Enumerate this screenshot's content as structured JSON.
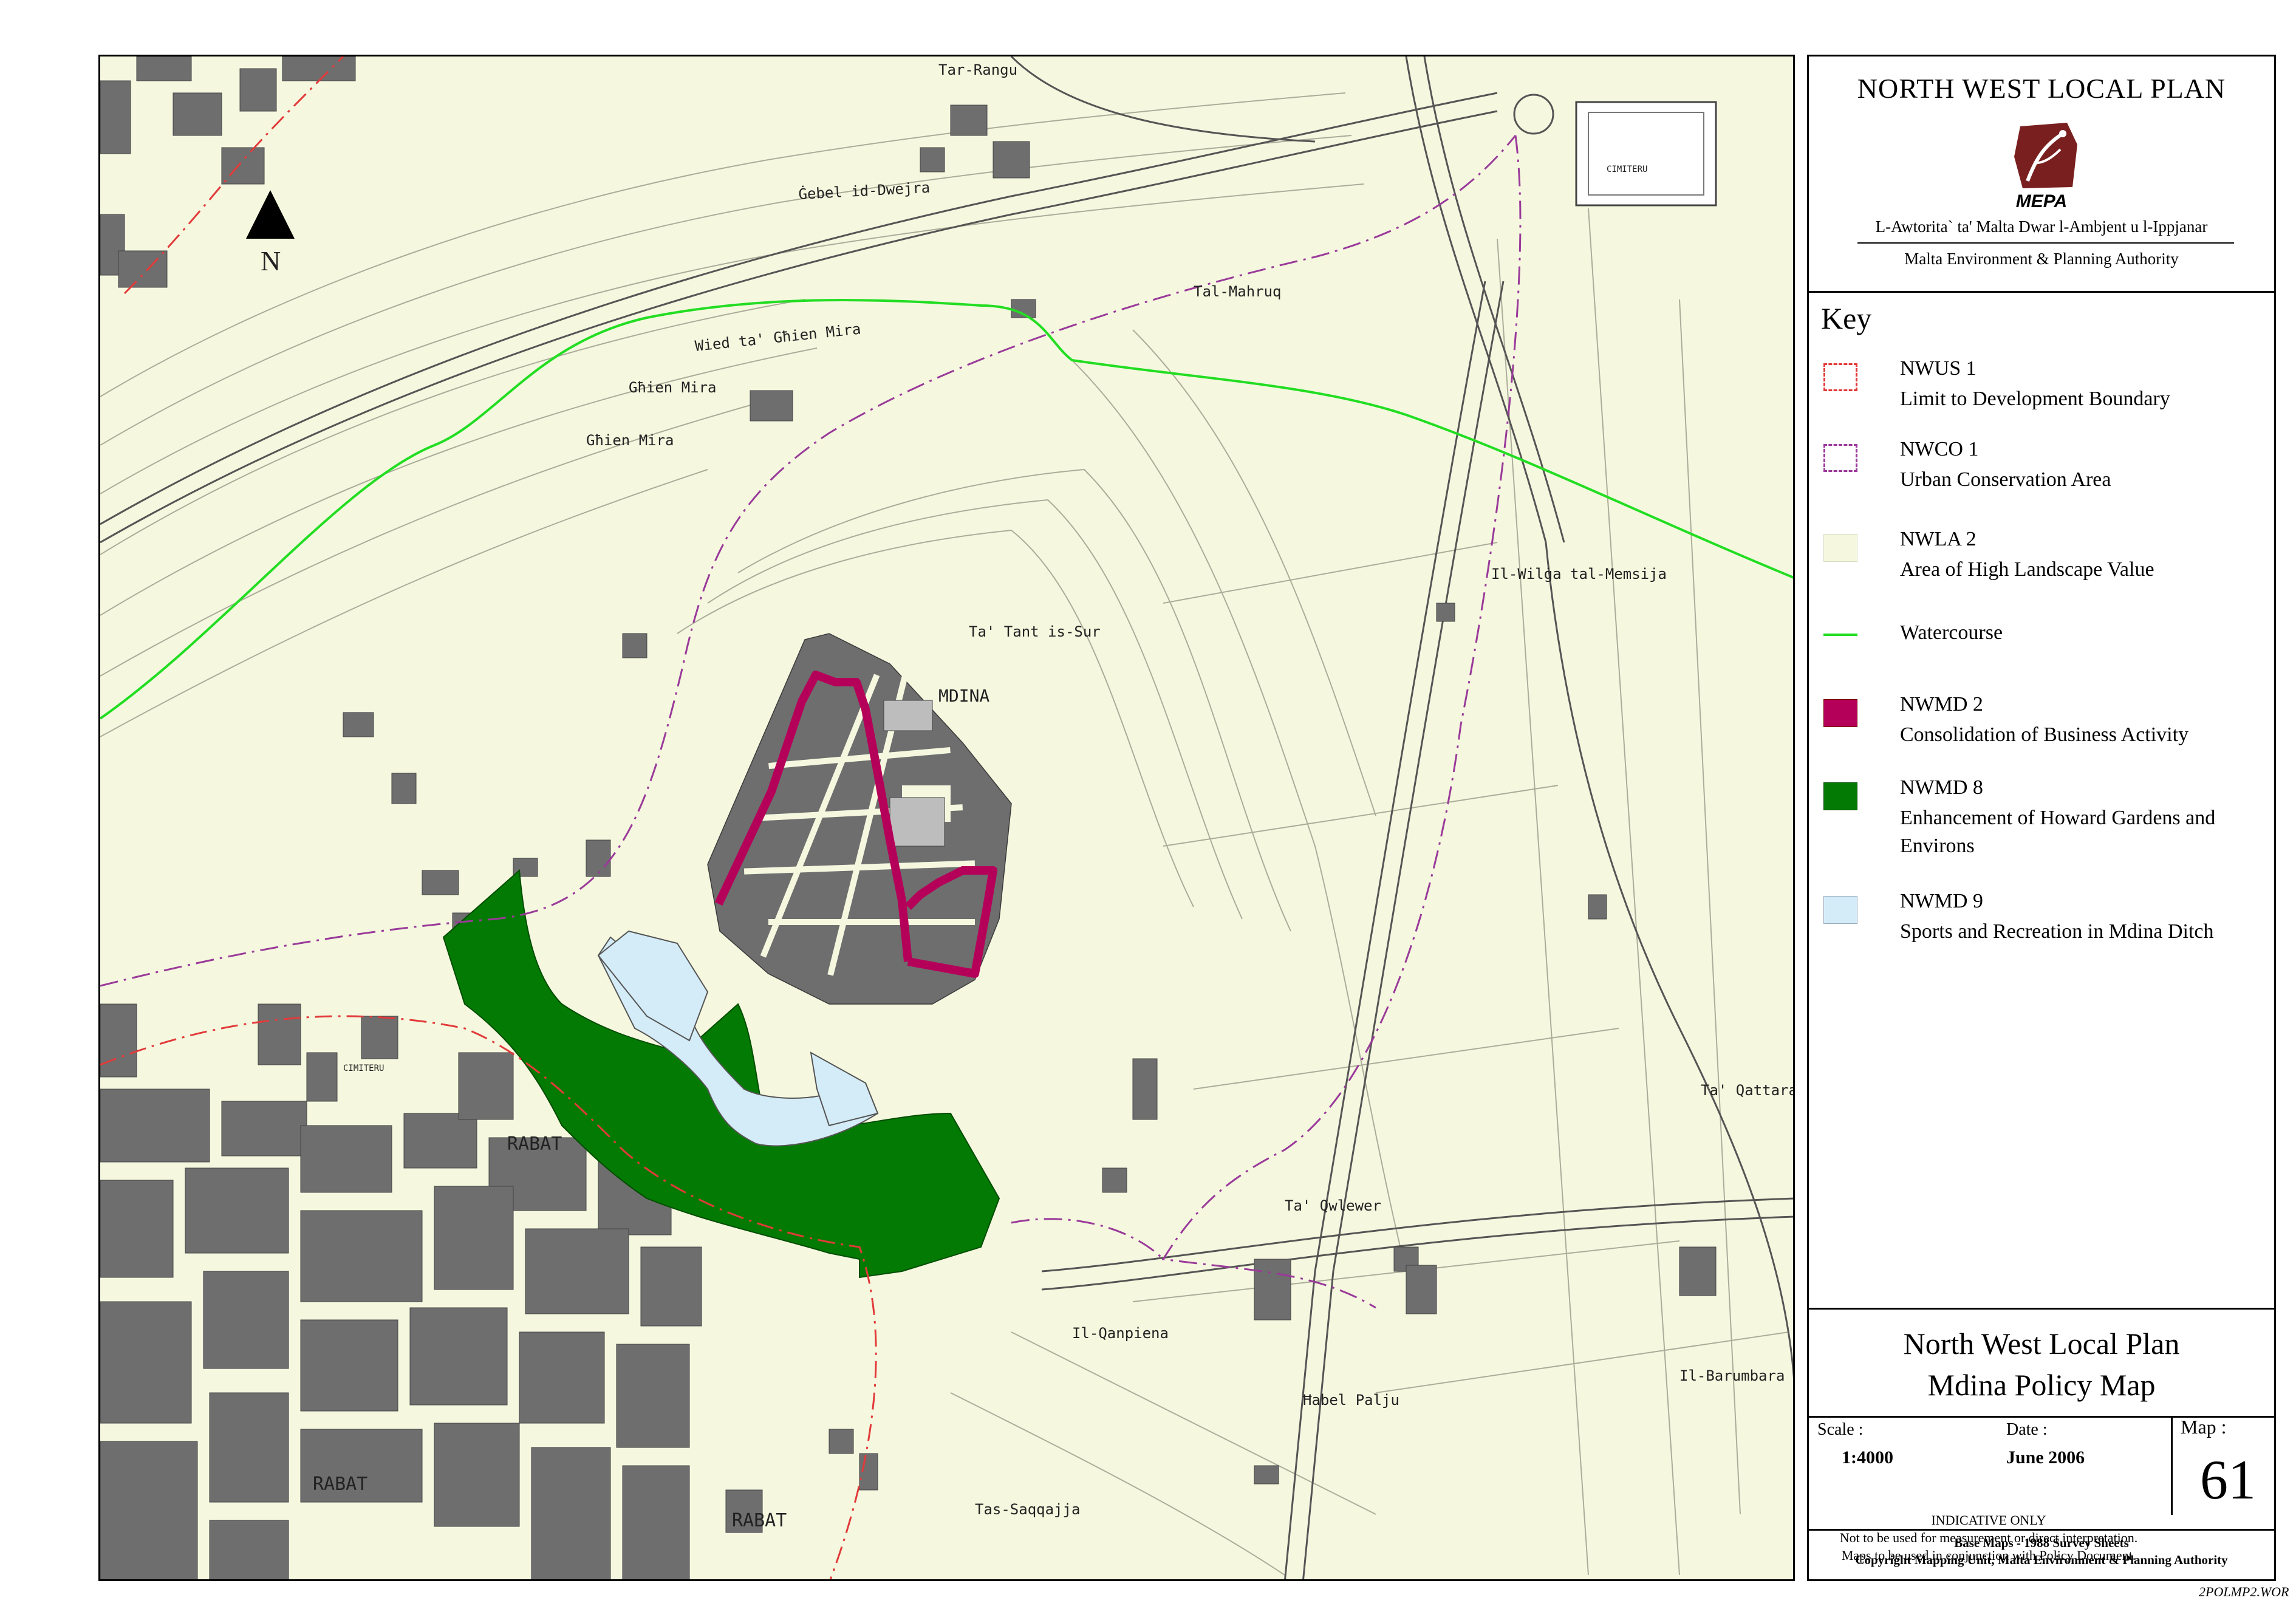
{
  "panel": {
    "plan_title": "NORTH WEST LOCAL PLAN",
    "logo_text": "MEPA",
    "authority_mt": "L-Awtorita` ta' Malta Dwar l-Ambjent u l-Ippjanar",
    "authority_en": "Malta Environment & Planning Authority",
    "key_title": "Key",
    "legend": [
      {
        "code": "NWUS 1",
        "label": "Limit to Development Boundary",
        "style": "dashed",
        "color": "#e23a3a"
      },
      {
        "code": "NWCO 1",
        "label": "Urban Conservation Area",
        "style": "dashdot",
        "color": "#9a3a9a"
      },
      {
        "code": "NWLA 2",
        "label": "Area of High Landscape Value",
        "style": "fill",
        "color": "#f5f8df"
      },
      {
        "code": "",
        "label": "Watercourse",
        "style": "line",
        "color": "#22dd22"
      },
      {
        "code": "NWMD 2",
        "label": "Consolidation of Business Activity",
        "style": "fill",
        "color": "#b5005a"
      },
      {
        "code": "NWMD 8",
        "label": "Enhancement of Howard Gardens and Environs",
        "style": "fill",
        "color": "#037a03"
      },
      {
        "code": "NWMD 9",
        "label": "Sports and Recreation in Mdina Ditch",
        "style": "fill",
        "color": "#d4ecf7"
      }
    ],
    "subtitle_1": "North West Local Plan",
    "subtitle_2": "Mdina Policy Map",
    "scale_label": "Scale :",
    "scale_value": "1:4000",
    "date_label": "Date :",
    "date_value": "June 2006",
    "map_label": "Map :",
    "map_number": "61",
    "disclaimer": [
      "INDICATIVE ONLY",
      "Not to be used for measurement or direct interpretation.",
      "Maps to be used in conjunction with Policy Document."
    ],
    "base_maps": [
      "Base Maps - 1988 Survey Sheets",
      "Copyright Mapping Unit, Malta Environment & Planning Authority"
    ]
  },
  "file_ref": "2POLMP2.WOR",
  "map": {
    "north_label": "N",
    "place_labels": [
      "Tar-Rangu",
      "Ġebel id-Dwejra",
      "Tal-Mahruq",
      "Wied ta' Għien Mira",
      "Għien Mira",
      "Għien Mira",
      "Il-Wilġa tal-Memsija",
      "Ta' Tant is-Sur",
      "MDINA",
      "Ta' Qattara",
      "Ta' Qwlewer",
      "Il-Qanpiena",
      "Il-Barumbara",
      "Ħabel Palju",
      "Tas-Saqqajja",
      "RABAT",
      "RABAT",
      "RABAT",
      "CIMITERU",
      "CIMITERU"
    ]
  }
}
